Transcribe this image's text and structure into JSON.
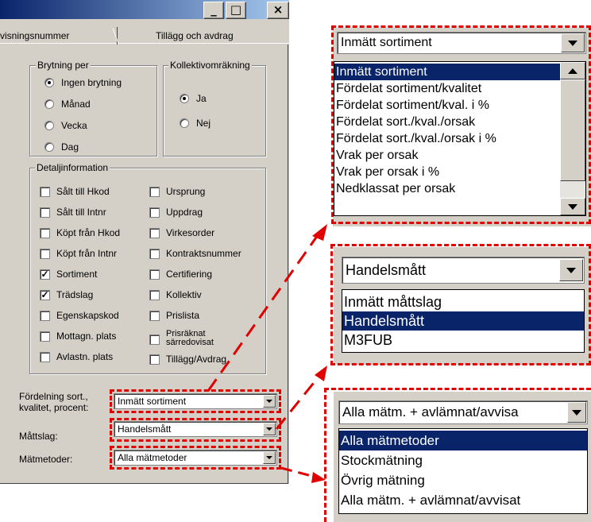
{
  "window": {
    "buttons": {
      "minimize": "_",
      "maximize": "□",
      "close": "×"
    },
    "tabs": [
      "visningsnummer",
      "Tillägg och avdrag"
    ]
  },
  "brytning": {
    "legend": "Brytning per",
    "options": [
      {
        "label": "Ingen brytning",
        "selected": true
      },
      {
        "label": "Månad",
        "selected": false
      },
      {
        "label": "Vecka",
        "selected": false
      },
      {
        "label": "Dag",
        "selected": false
      }
    ]
  },
  "kollektiv": {
    "legend": "Kollektivomräkning",
    "options": [
      {
        "label": "Ja",
        "selected": true
      },
      {
        "label": "Nej",
        "selected": false
      }
    ]
  },
  "detalj": {
    "legend": "Detaljinformation",
    "left": [
      {
        "label": "Sålt till Hkod",
        "checked": false
      },
      {
        "label": "Sålt till Intnr",
        "checked": false
      },
      {
        "label": "Köpt från Hkod",
        "checked": false
      },
      {
        "label": "Köpt från Intnr",
        "checked": false
      },
      {
        "label": "Sortiment",
        "checked": true
      },
      {
        "label": "Trädslag",
        "checked": true
      },
      {
        "label": "Egenskapskod",
        "checked": false
      },
      {
        "label": "Mottagn. plats",
        "checked": false
      },
      {
        "label": "Avlastn. plats",
        "checked": false
      }
    ],
    "right": [
      {
        "label": "Ursprung",
        "checked": false
      },
      {
        "label": "Uppdrag",
        "checked": false
      },
      {
        "label": "Virkesorder",
        "checked": false
      },
      {
        "label": "Kontraktsnummer",
        "checked": false
      },
      {
        "label": "Certifiering",
        "checked": false
      },
      {
        "label": "Kollektiv",
        "checked": false
      },
      {
        "label": "Prislista",
        "checked": false
      },
      {
        "label": "Prisräknat särredovisat",
        "checked": false
      },
      {
        "label": "Tillägg/Avdrag",
        "checked": false
      }
    ]
  },
  "fields": {
    "fordelning": {
      "label1": "Fördelning sort.,",
      "label2": "kvalitet, procent:",
      "value": "Inmätt sortiment"
    },
    "mattslag": {
      "label": "Måttslag:",
      "value": "Handelsmått"
    },
    "matmetoder": {
      "label": "Mätmetoder:",
      "value": "Alla mätmetoder"
    }
  },
  "zoom1": {
    "value": "Inmätt sortiment",
    "items": [
      "Inmätt sortiment",
      "Fördelat sortiment/kvalitet",
      "Fördelat sortiment/kval. i %",
      "Fördelat sort./kval./orsak",
      "Fördelat sort./kval./orsak i %",
      "Vrak per orsak",
      "Vrak per orsak i %",
      "Nedklassat per orsak"
    ],
    "selected": 0
  },
  "zoom2": {
    "value": "Handelsmått",
    "items": [
      "Inmätt måttslag",
      "Handelsmått",
      "M3FUB"
    ],
    "selected": 1
  },
  "zoom3": {
    "value": "Alla mätm. + avlämnat/avvisa",
    "items": [
      "Alla mätmetoder",
      "Stockmätning",
      "Övrig mätning",
      "Alla mätm. + avlämnat/avvisat"
    ],
    "selected": 0
  },
  "colors": {
    "accent": "#e00000",
    "selection": "#0a246a",
    "face": "#d4d0c8"
  }
}
